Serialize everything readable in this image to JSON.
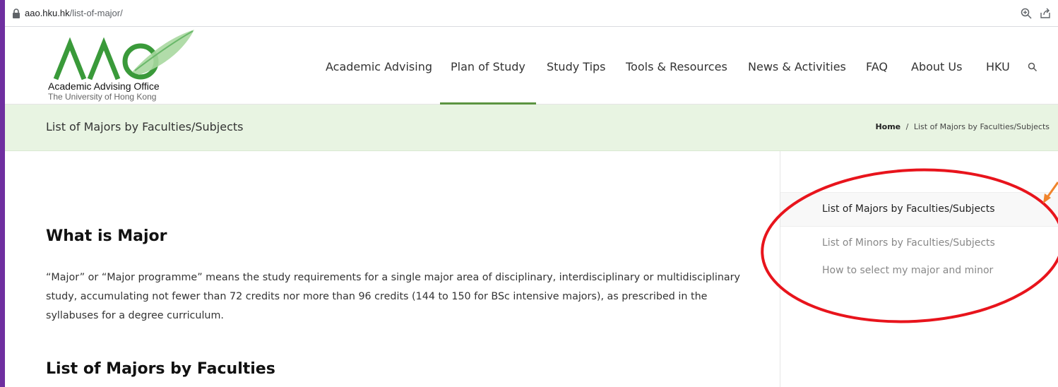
{
  "browser": {
    "url_host": "aao.hku.hk",
    "url_path": "/list-of-major/"
  },
  "logo": {
    "line1": "Academic Advising Office",
    "line2": "The University of Hong Kong"
  },
  "nav": {
    "items": [
      {
        "label": "Academic Advising"
      },
      {
        "label": "Plan of Study"
      },
      {
        "label": "Study Tips"
      },
      {
        "label": "Tools & Resources"
      },
      {
        "label": "News & Activities"
      },
      {
        "label": "FAQ"
      },
      {
        "label": "About Us"
      },
      {
        "label": "HKU"
      }
    ],
    "active": "Plan of Study",
    "accent_color": "#5c9441"
  },
  "titlebar": {
    "title": "List of Majors by Faculties/Subjects",
    "breadcrumb_home": "Home",
    "breadcrumb_sep": "/",
    "breadcrumb_current": "List of Majors by Faculties/Subjects",
    "bg_color": "#e8f4e2"
  },
  "main": {
    "heading1": "What is Major",
    "paragraph": "“Major” or “Major programme” means the study requirements for a single major area of disciplinary, interdisciplinary or multidisciplinary study, accumulating not fewer than 72 credits nor more than 96 credits (144 to 150 for BSc intensive majors), as prescribed in the syllabuses for a degree curriculum.",
    "heading2": "List of Majors by Faculties"
  },
  "sidebar": {
    "links": [
      {
        "label": "List of Majors by Faculties/Subjects",
        "active": true
      },
      {
        "label": "List of Minors by Faculties/Subjects",
        "active": false
      },
      {
        "label": "How to select my major and minor",
        "active": false
      }
    ]
  },
  "annotation": {
    "circle_color": "#e8141c",
    "arrow_color": "#f0842c"
  }
}
